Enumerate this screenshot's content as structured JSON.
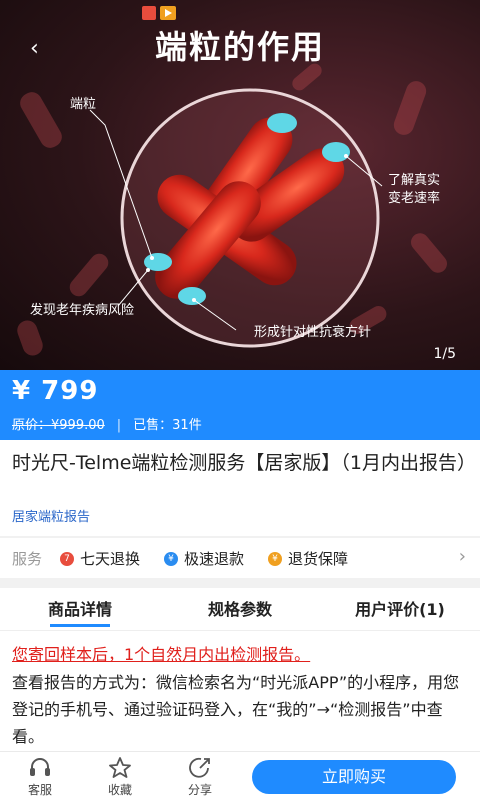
{
  "hero": {
    "title": "端粒的作用",
    "counter": "1/5",
    "labels": {
      "telomere": "端粒",
      "rate_line1": "了解真实",
      "rate_line2": "变老速率",
      "disease": "发现老年疾病风险",
      "plan": "形成针对性抗衰方针"
    }
  },
  "price": {
    "current": "¥ 799",
    "original": "原价：¥999.00",
    "sold": "已售：31件"
  },
  "product": {
    "title": "时光尺-Telme端粒检测服务【居家版】（1月内出报告）",
    "tag": "居家端粒报告"
  },
  "services": {
    "label": "服务",
    "items": [
      "七天退换",
      "极速退款",
      "退货保障"
    ]
  },
  "tabs": [
    "商品详情",
    "规格参数",
    "用户评价(1)"
  ],
  "content": {
    "notice": "您寄回样本后，1个自然月内出检测报告。",
    "body": "查看报告的方式为：微信检索名为“时光派APP”的小程序，用您登记的手机号、通过验证码登入，在“我的”→“检测报告”中查看。"
  },
  "bottom": {
    "service": "客服",
    "favorite": "收藏",
    "share": "分享",
    "buy": "立即购买"
  },
  "colors": {
    "accent": "#1f8bff",
    "notice": "#e0201c",
    "tag": "#2a66c9"
  }
}
